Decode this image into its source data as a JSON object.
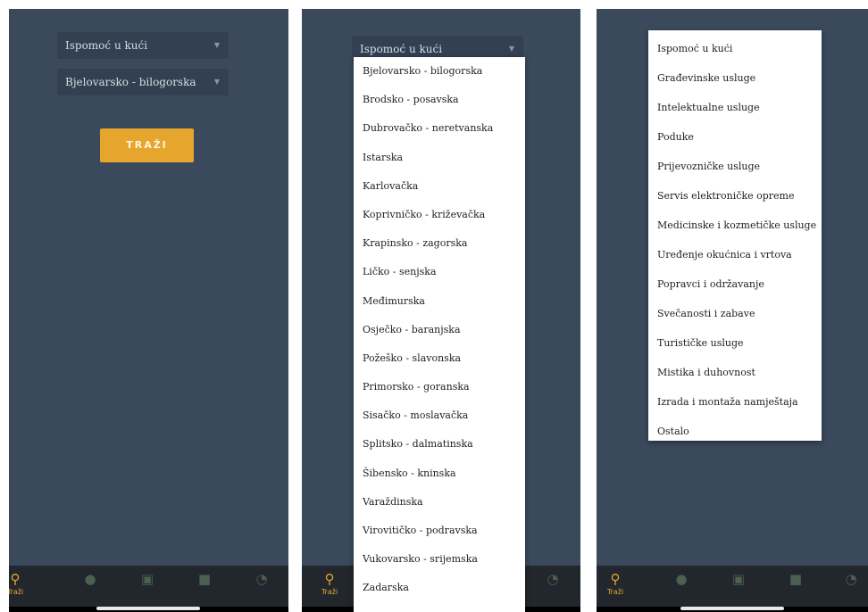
{
  "screens": {
    "first": {
      "category_select": "Ispomoć u kući",
      "county_select": "Bjelovarsko - bilogorska",
      "search_button": "TRAŽI",
      "tab_label": "Traži"
    },
    "second": {
      "category_select": "Ispomoć u kući",
      "tab_label": "Traži",
      "county_options": [
        "Bjelovarsko - bilogorska",
        "Brodsko - posavska",
        "Dubrovačko - neretvanska",
        "Istarska",
        "Karlovačka",
        "Koprivničko - križevačka",
        "Krapinsko - zagorska",
        "Ličko - senjska",
        "Međimurska",
        "Osječko - baranjska",
        "Požeško - slavonska",
        "Primorsko - goranska",
        "Sisačko - moslavačka",
        "Splitsko - dalmatinska",
        "Šibensko - kninska",
        "Varaždinska",
        "Virovitičko - podravska",
        "Vukovarsko - srijemska",
        "Zadarska"
      ]
    },
    "third": {
      "tab_label": "Traži",
      "category_options": [
        "Ispomoć u kući",
        "Građevinske usluge",
        "Intelektualne usluge",
        "Poduke",
        "Prijevozničke usluge",
        "Servis elektroničke opreme",
        "Medicinske i kozmetičke usluge",
        "Uređenje okućnica i vrtova",
        "Popravci i održavanje",
        "Svečanosti i zabave",
        "Turističke usluge",
        "Mistika i duhovnost",
        "Izrada i montaža namještaja",
        "Ostalo"
      ]
    }
  },
  "icons": {
    "tabs": [
      "search-icon",
      "person-icon",
      "chat-icon",
      "briefcase-icon",
      "clock-icon"
    ],
    "dropdown": "caret-down-icon"
  },
  "colors": {
    "background": "#3a4a5c",
    "select_background": "#324052",
    "accent": "#e6a52c",
    "tabbar": "#22272d",
    "menu_background": "#ffffff"
  }
}
